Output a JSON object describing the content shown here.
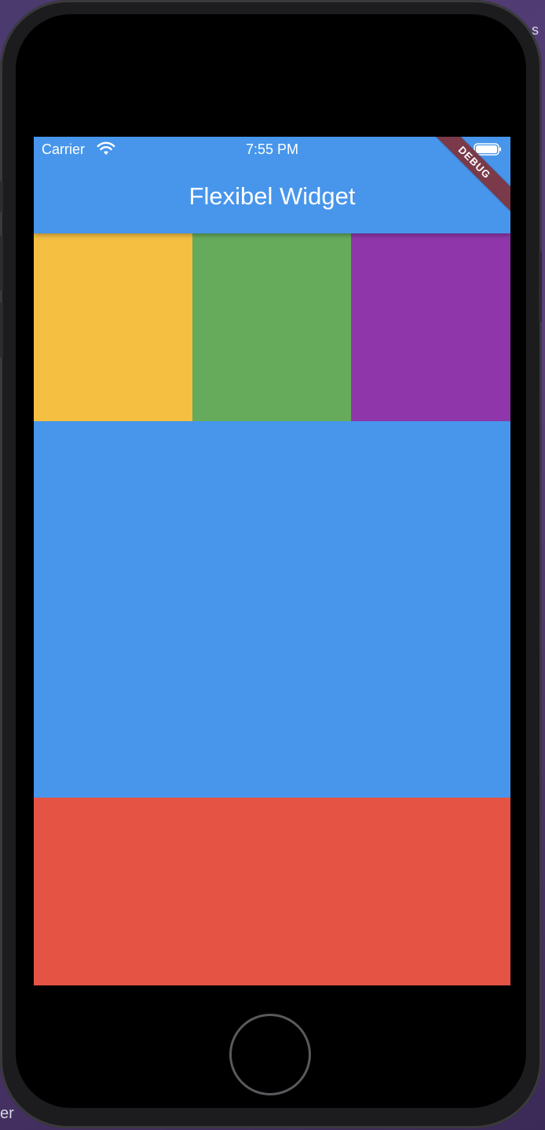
{
  "backdrop": {
    "top_right_text": "s",
    "bottom_left_text": "er",
    "bottom_slash": "/"
  },
  "status_bar": {
    "carrier": "Carrier",
    "time": "7:55 PM"
  },
  "app_bar": {
    "title": "Flexibel Widget"
  },
  "debug_banner": {
    "label": "DEBUG"
  },
  "colors": {
    "app_bar": "#4796eb",
    "yellow": "#f5bf42",
    "green": "#66ab5c",
    "purple": "#8f37aa",
    "blue": "#4796eb",
    "red": "#e45343",
    "debug_banner": "#7a3a4a"
  },
  "icons": {
    "wifi": "wifi-icon",
    "battery": "battery-icon"
  }
}
